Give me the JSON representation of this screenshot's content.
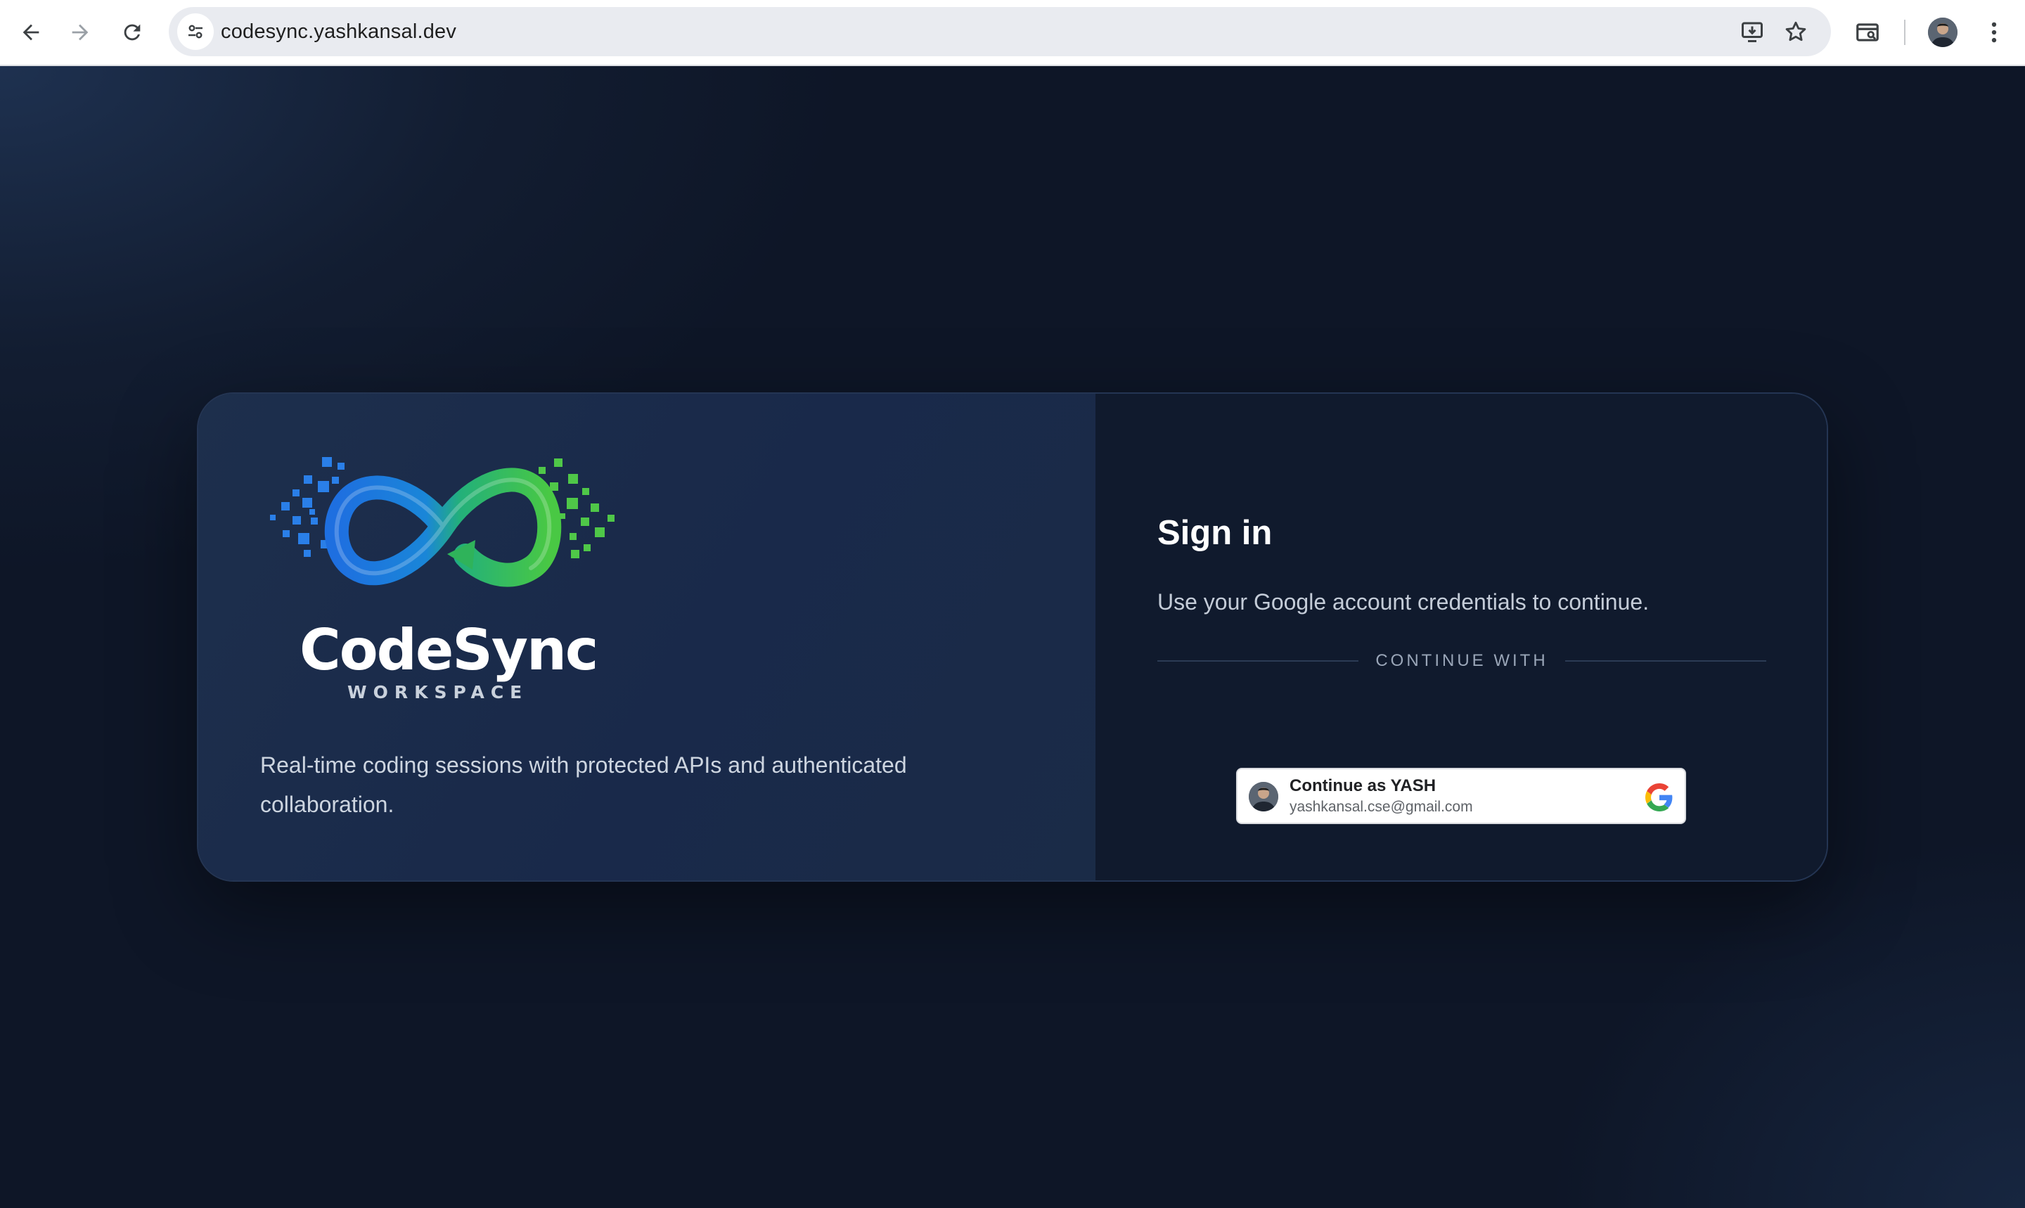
{
  "browser": {
    "url": "codesync.yashkansal.dev",
    "icons": {
      "back": "arrow-left-icon",
      "forward": "arrow-right-icon",
      "reload": "reload-icon",
      "site_info": "tune-icon",
      "install": "install-app-icon",
      "bookmark": "star-icon",
      "lens": "search-tab-icon",
      "profile": "avatar",
      "menu": "more-vert-icon"
    }
  },
  "brand": {
    "name": "CodeSync",
    "subtitle": "WORKSPACE",
    "colors": {
      "blue": "#1e74e0",
      "green": "#3ec04a"
    }
  },
  "hero": {
    "tagline": "Real-time coding sessions with protected APIs and authenticated collaboration."
  },
  "signin": {
    "title": "Sign in",
    "description": "Use your Google account credentials to continue.",
    "divider_label": "CONTINUE WITH",
    "google_button": {
      "name_label": "Continue as YASH",
      "email": "yashkansal.cse@gmail.com"
    }
  }
}
